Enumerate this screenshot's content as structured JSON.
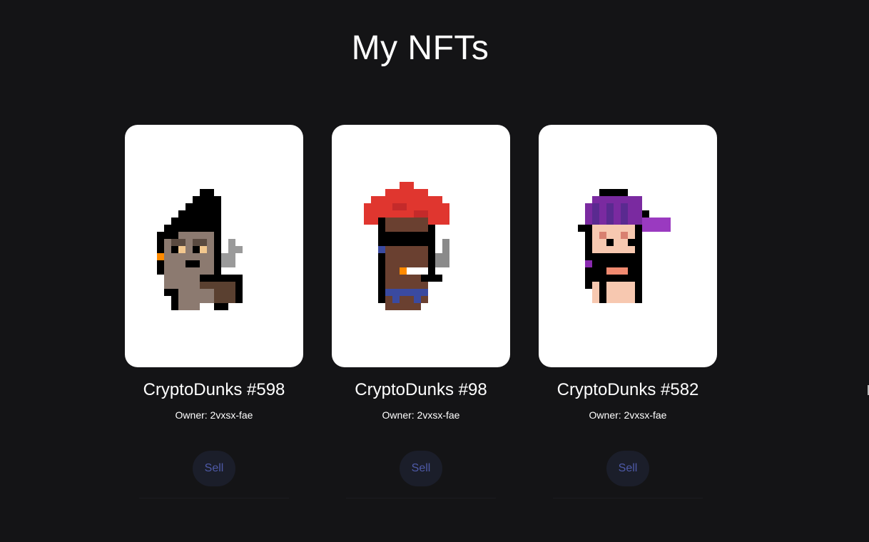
{
  "page": {
    "title": "My NFTs"
  },
  "colors": {
    "background": "#141416",
    "card": "#ffffff",
    "sell_bg": "#1b1e2a",
    "sell_text": "#4e5aa8"
  },
  "nfts": [
    {
      "name": "CryptoDunks #598",
      "owner": "Owner: 2vxsx-fae",
      "sell_label": "Sell",
      "avatar": "pixel-punk-pipe-icon"
    },
    {
      "name": "CryptoDunks #98",
      "owner": "Owner: 2vxsx-fae",
      "sell_label": "Sell",
      "avatar": "pixel-punk-red-hair-icon"
    },
    {
      "name": "CryptoDunks #582",
      "owner": "Owner: 2vxsx-fae",
      "sell_label": "Sell",
      "avatar": "pixel-punk-cap-icon"
    }
  ]
}
